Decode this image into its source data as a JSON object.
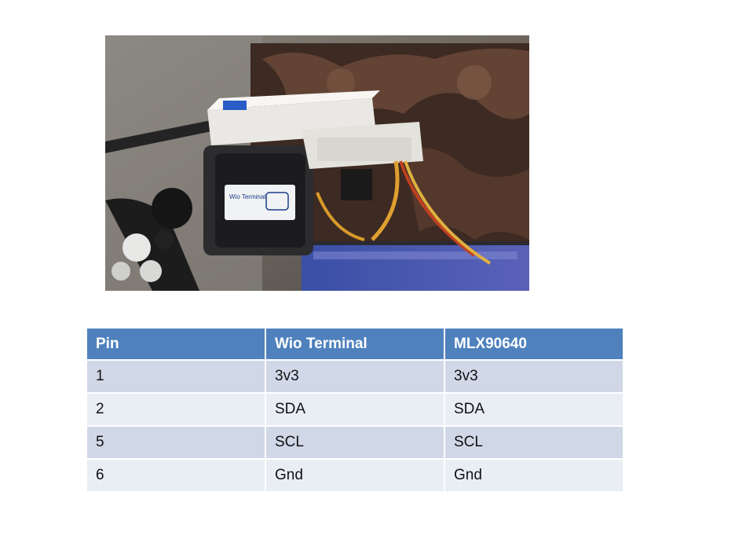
{
  "table": {
    "headers": [
      "Pin",
      "Wio Terminal",
      "MLX90640"
    ],
    "rows": [
      [
        "1",
        "3v3",
        "3v3"
      ],
      [
        "2",
        "SDA",
        "SDA"
      ],
      [
        "5",
        "SCL",
        "SCL"
      ],
      [
        "6",
        "Gnd",
        "Gnd"
      ]
    ]
  },
  "photo": {
    "device_label": "Wio Terminal"
  },
  "colors": {
    "header_bg": "#4f81bd",
    "row_odd": "#d0d8e8",
    "row_even": "#e9edf4"
  }
}
